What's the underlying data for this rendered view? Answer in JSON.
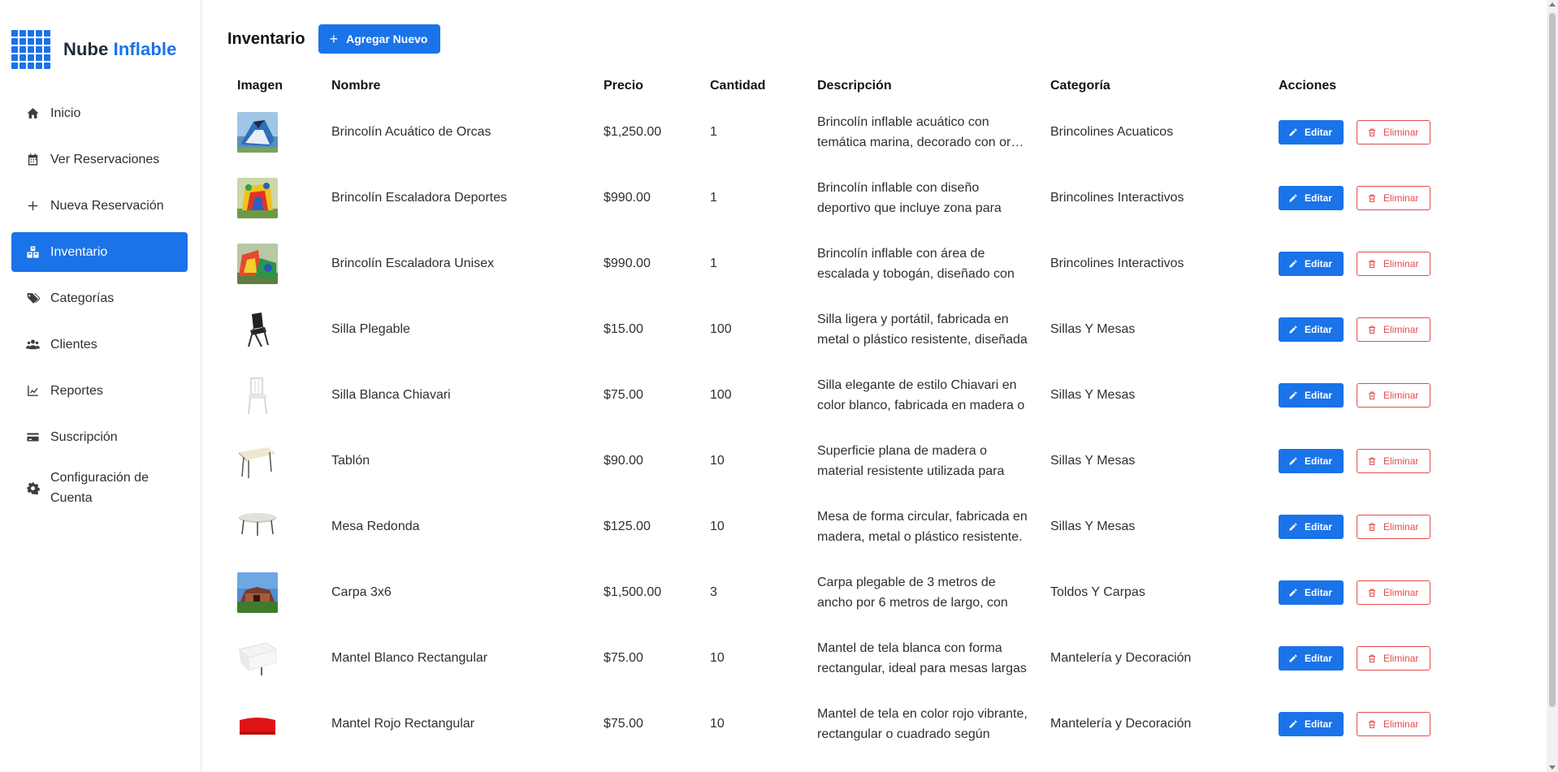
{
  "brand": {
    "name_part1": "Nube",
    "name_part2": "Inflable",
    "color": "#1a73e8"
  },
  "sidebar": {
    "items": [
      {
        "label": "Inicio",
        "icon": "home-icon",
        "active": false
      },
      {
        "label": "Ver Reservaciones",
        "icon": "calendar-icon",
        "active": false
      },
      {
        "label": "Nueva Reservación",
        "icon": "plus-icon",
        "active": false
      },
      {
        "label": "Inventario",
        "icon": "boxes-icon",
        "active": true
      },
      {
        "label": "Categorías",
        "icon": "tags-icon",
        "active": false
      },
      {
        "label": "Clientes",
        "icon": "users-icon",
        "active": false
      },
      {
        "label": "Reportes",
        "icon": "chart-line-icon",
        "active": false
      },
      {
        "label": "Suscripción",
        "icon": "credit-card-icon",
        "active": false
      },
      {
        "label": "Configuración de Cuenta",
        "icon": "gear-icon",
        "active": false
      }
    ]
  },
  "header": {
    "title": "Inventario",
    "add_label": "Agregar Nuevo"
  },
  "table": {
    "columns": [
      "Imagen",
      "Nombre",
      "Precio",
      "Cantidad",
      "Descripción",
      "Categoría",
      "Acciones"
    ],
    "edit_label": "Editar",
    "delete_label": "Eliminar",
    "rows": [
      {
        "name": "Brincolín Acuático de Orcas",
        "price": "$1,250.00",
        "qty": "1",
        "desc1": "Brincolín inflable acuático con",
        "desc2": "temática marina, decorado con orcas",
        "category": "Brincolines Acuaticos",
        "image": "water-slide-image"
      },
      {
        "name": "Brincolín Escaladora Deportes",
        "price": "$990.00",
        "qty": "1",
        "desc1": "Brincolín inflable con diseño",
        "desc2": "deportivo que incluye zona para",
        "category": "Brincolines Interactivos",
        "image": "sports-bouncer-image"
      },
      {
        "name": "Brincolín Escaladora Unisex",
        "price": "$990.00",
        "qty": "1",
        "desc1": "Brincolín inflable con área de",
        "desc2": "escalada y tobogán, diseñado con",
        "category": "Brincolines Interactivos",
        "image": "climbing-bouncer-image"
      },
      {
        "name": "Silla Plegable",
        "price": "$15.00",
        "qty": "100",
        "desc1": "Silla ligera y portátil, fabricada en",
        "desc2": "metal o plástico resistente, diseñada",
        "category": "Sillas Y Mesas",
        "image": "folding-chair-image"
      },
      {
        "name": "Silla Blanca Chiavari",
        "price": "$75.00",
        "qty": "100",
        "desc1": "Silla elegante de estilo Chiavari en",
        "desc2": "color blanco, fabricada en madera o",
        "category": "Sillas Y Mesas",
        "image": "chiavari-chair-image"
      },
      {
        "name": "Tablón",
        "price": "$90.00",
        "qty": "10",
        "desc1": "Superficie plana de madera o",
        "desc2": "material resistente utilizada para",
        "category": "Sillas Y Mesas",
        "image": "folding-table-image"
      },
      {
        "name": "Mesa Redonda",
        "price": "$125.00",
        "qty": "10",
        "desc1": "Mesa de forma circular, fabricada en",
        "desc2": "madera, metal o plástico resistente.",
        "category": "Sillas Y Mesas",
        "image": "round-table-image"
      },
      {
        "name": "Carpa 3x6",
        "price": "$1,500.00",
        "qty": "3",
        "desc1": "Carpa plegable de 3 metros de",
        "desc2": "ancho por 6 metros de largo, con",
        "category": "Toldos Y Carpas",
        "image": "tent-image"
      },
      {
        "name": "Mantel Blanco Rectangular",
        "price": "$75.00",
        "qty": "10",
        "desc1": "Mantel de tela blanca con forma",
        "desc2": "rectangular, ideal para mesas largas",
        "category": "Mantelería y Decoración",
        "image": "white-tablecloth-image"
      },
      {
        "name": "Mantel Rojo Rectangular",
        "price": "$75.00",
        "qty": "10",
        "desc1": "Mantel de tela en color rojo vibrante,",
        "desc2": "rectangular o cuadrado según",
        "category": "Mantelería y Decoración",
        "image": "red-tablecloth-image"
      }
    ]
  }
}
